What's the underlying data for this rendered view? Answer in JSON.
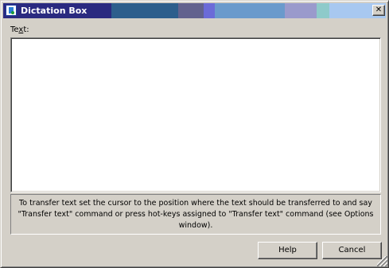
{
  "window": {
    "title": "Dictation Box",
    "close_glyph": "✕",
    "title_bar_colors": [
      "#2a2a80",
      "#2c5e8c",
      "#62628e",
      "#6b6bd8",
      "#6a9acc",
      "#9a9acc",
      "#8ecaca",
      "#a8c8f0"
    ]
  },
  "icons": {
    "app": "dictation-app-icon",
    "close": "close-icon"
  },
  "text_field": {
    "label_prefix": "Te",
    "label_accel": "x",
    "label_suffix": "t:",
    "value": ""
  },
  "info": {
    "text": "To transfer text set the cursor to the position where the text should be transferred to and say \"Transfer text\" command or press hot-keys assigned to \"Transfer text\" command (see Options window)."
  },
  "buttons": {
    "help": "Help",
    "cancel": "Cancel"
  }
}
